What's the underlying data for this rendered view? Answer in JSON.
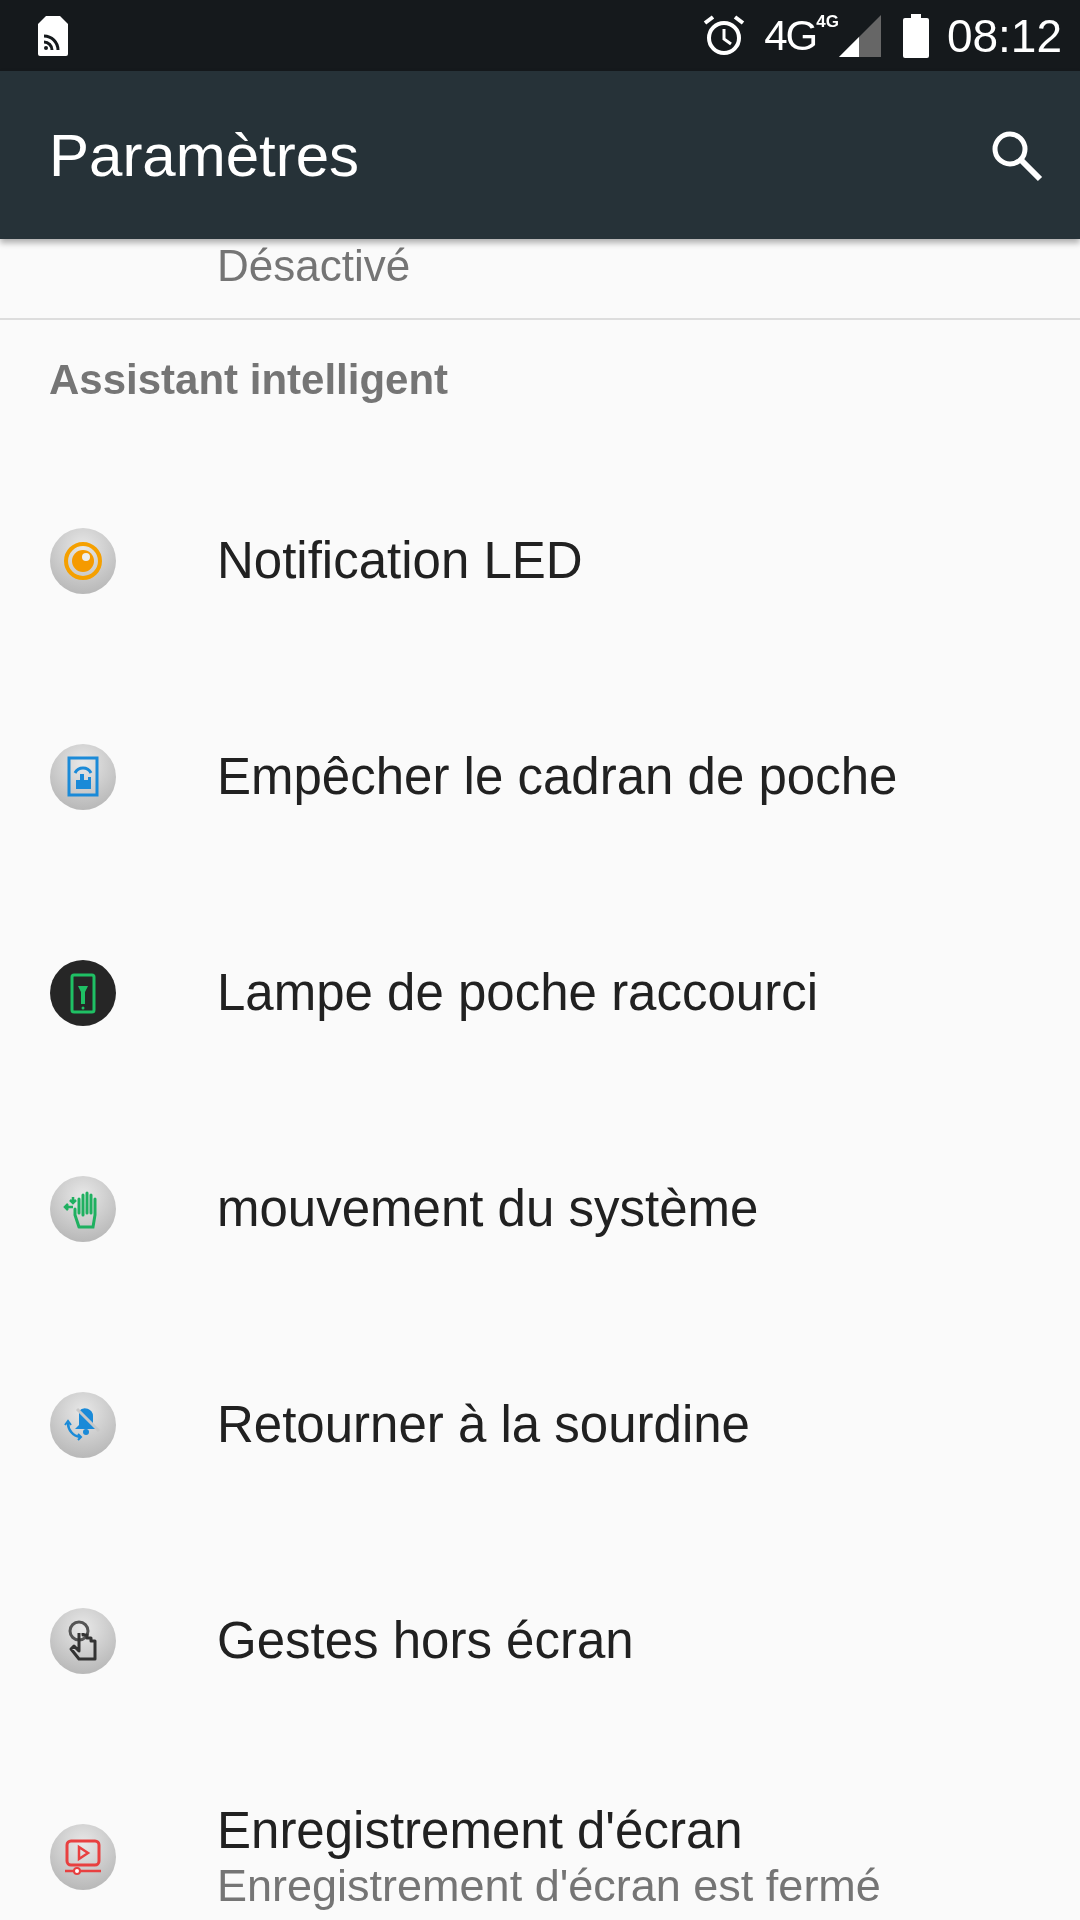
{
  "status_bar": {
    "network": "4G",
    "network_badge": "4G",
    "time": "08:12"
  },
  "app_bar": {
    "title": "Paramètres"
  },
  "previous_item": {
    "subtitle": "Désactivé"
  },
  "section": {
    "title": "Assistant intelligent"
  },
  "items": [
    {
      "kind": "led",
      "title": "Notification LED"
    },
    {
      "kind": "pocket",
      "title": "Empêcher le cadran de poche"
    },
    {
      "kind": "flashlight",
      "title": "Lampe de poche raccourci"
    },
    {
      "kind": "gesture",
      "title": "mouvement du système"
    },
    {
      "kind": "mute",
      "title": "Retourner à la sourdine"
    },
    {
      "kind": "touch",
      "title": "Gestes hors écran"
    },
    {
      "kind": "record",
      "title": "Enregistrement d'écran",
      "subtitle": "Enregistrement d'écran est fermé"
    }
  ]
}
